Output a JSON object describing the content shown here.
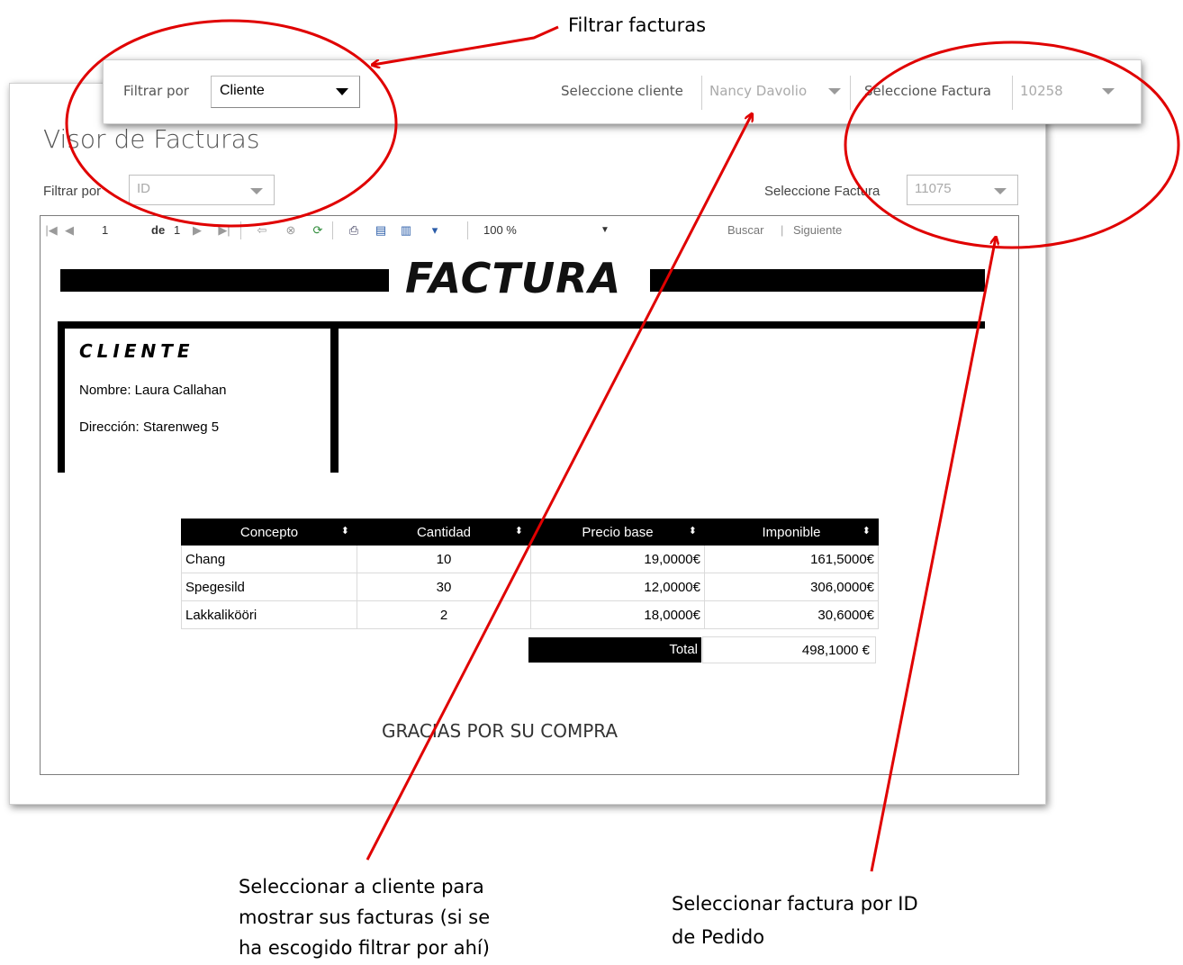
{
  "annotations": {
    "filtrar_facturas": "Filtrar facturas",
    "seleccionar_cliente": [
      "Seleccionar a cliente para",
      "mostrar sus facturas (si se",
      "ha escogido filtrar por ahí)"
    ],
    "seleccionar_factura": [
      "Seleccionar factura por ID",
      "de Pedido"
    ]
  },
  "filter_bar": {
    "filter_label": "Filtrar por",
    "filter_value": "Cliente",
    "client_label": "Seleccione cliente",
    "client_value": "Nancy Davolio",
    "invoice_label": "Seleccione Factura",
    "invoice_value": "10258"
  },
  "window": {
    "title": "Visor de Facturas",
    "filter_label": "Filtrar por",
    "filter_value": "ID",
    "invoice_label": "Seleccione Factura",
    "invoice_value": "11075"
  },
  "toolbar": {
    "page": "1",
    "of_label": "de",
    "total_pages": "1",
    "zoom": "100 %",
    "find_label": "Buscar",
    "next_label": "Siguiente",
    "icons": [
      "first-page-icon",
      "prev-page-icon",
      "next-page-icon",
      "last-page-icon",
      "back-icon",
      "stop-icon",
      "refresh-icon",
      "print-icon",
      "print-layout-icon",
      "page-setup-icon",
      "export-icon"
    ]
  },
  "invoice": {
    "title": "FACTURA",
    "client_header": "CLIENTE",
    "client_name": "Nombre: Laura Callahan",
    "client_address": "Dirección: Starenweg 5",
    "columns": [
      "Concepto",
      "Cantidad",
      "Precio base",
      "Imponible"
    ],
    "rows": [
      [
        "Chang",
        "10",
        "19,0000€",
        "161,5000€"
      ],
      [
        "Spegesild",
        "30",
        "12,0000€",
        "306,0000€"
      ],
      [
        "Lakkalikööri",
        "2",
        "18,0000€",
        "30,6000€"
      ]
    ],
    "total_label": "Total",
    "total_value": "498,1000 €",
    "thanks": "GRACIAS POR SU COMPRA"
  },
  "colors": {
    "annotation_red": "#e00000",
    "header_black": "#000000"
  }
}
